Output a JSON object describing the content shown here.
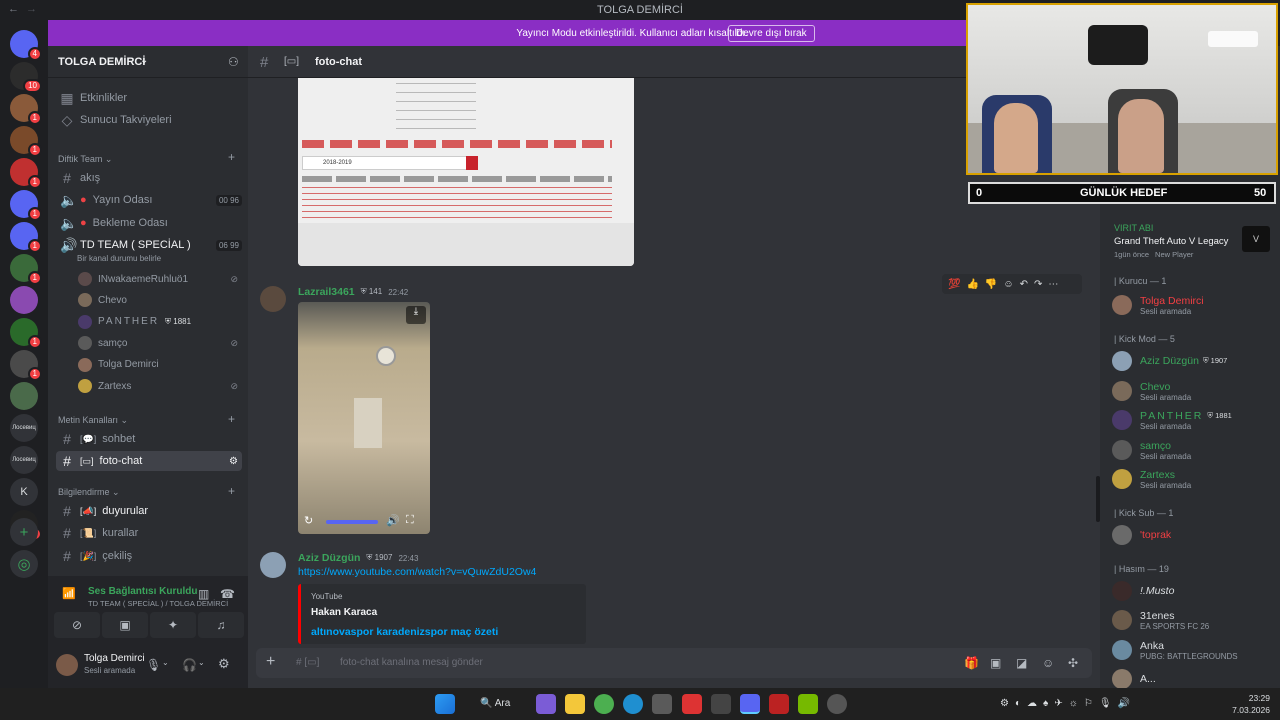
{
  "window": {
    "title": "TOLGA DEMİRCİ"
  },
  "banner": {
    "message": "Yayıncı Modu etkinleştirildi. Kullanıcı adları kısaltıldı.",
    "button": "Devre dışı bırak"
  },
  "servers": [
    {
      "badge": "4"
    },
    {
      "badge": "10"
    },
    {
      "badge": "1"
    },
    {
      "badge": "1"
    },
    {
      "badge": "1"
    },
    {
      "badge": "1"
    },
    {
      "badge": "1"
    },
    {
      "badge": "1"
    },
    {
      "badge": ""
    },
    {
      "badge": "1"
    },
    {
      "badge": "1"
    },
    {
      "badge": ""
    },
    {
      "label": "Лосевиц"
    },
    {
      "label": "Лосевиц"
    },
    {
      "label": "K"
    },
    {
      "badge": "1"
    }
  ],
  "guild": {
    "name": "TOLGA DEMİRCİ"
  },
  "nav": {
    "events": "Etkinlikler",
    "boosts": "Sunucu Takviyeleri"
  },
  "cat1": {
    "name": "Diftik Team"
  },
  "ch_akis": "akış",
  "voice": {
    "yayin": "Yayın Odası",
    "yayin_counts": "00 96",
    "bekleme": "Bekleme Odası",
    "td": "TD TEAM ( SPECİAL )",
    "td_counts": "06 99",
    "td_status": "Bir kanal durumu belirle"
  },
  "voice_users": [
    "INwakaemeRuhluö1",
    "Chevo",
    "PANTHER",
    "samço",
    "Tolga Demirci",
    "Zartexs"
  ],
  "panther_badge": "1881",
  "cat2": {
    "name": "Metin Kanalları"
  },
  "ch_sohbet": "sohbet",
  "ch_foto": "foto-chat",
  "cat3": {
    "name": "Bilgilendirme"
  },
  "ch_duyurular": "duyurular",
  "ch_kurallar": "kurallar",
  "ch_cekilis": "çekiliş",
  "vp": {
    "status": "Ses Bağlantısı Kuruldu",
    "location": "TD TEAM ( SPECİAL ) / TOLGA DEMİRCİ"
  },
  "me": {
    "name": "Tolga Demirci",
    "status": "Sesli aramada"
  },
  "header": {
    "channel": "foto-chat"
  },
  "doc": {
    "season": "2018-2019"
  },
  "msg1": {
    "author": "Lazrail3461",
    "badge": "141",
    "time": "22:42"
  },
  "msg2": {
    "author": "Aziz Düzgün",
    "badge": "1907",
    "time": "22:43",
    "link": "https://www.youtube.com/watch?v=vQuwZdU2Ow4",
    "embed_provider": "YouTube",
    "embed_author": "Hakan Karaca",
    "embed_title": "altınovaspor karadenizspor maç özeti"
  },
  "composer": {
    "placeholder": "foto-chat kanalına mesaj gönder"
  },
  "stream": {
    "goal_left": "0",
    "goal_label": "GÜNLÜK HEDEF",
    "goal_right": "50"
  },
  "activity": {
    "name": "VIRIT ABI",
    "game": "Grand Theft Auto V Legacy",
    "meta": "1gün önce",
    "tag": "New Player"
  },
  "mcat": {
    "kurucu": "| Kurucu — 1",
    "kickmod": "| Kick Mod — 5",
    "kicksub": "| Kick Sub — 1",
    "hasim": "| Hasım — 19"
  },
  "members": {
    "tolga": {
      "name": "Tolga Demirci",
      "sub": "Sesli aramada",
      "color": "#f23f43"
    },
    "aziz": {
      "name": "Aziz Düzgün",
      "badge": "1907",
      "color": "#3ba55c"
    },
    "chevo": {
      "name": "Chevo",
      "sub": "Sesli aramada",
      "color": "#3ba55c"
    },
    "panther": {
      "name": "PANTHER",
      "badge": "1881",
      "sub": "Sesli aramada",
      "color": "#3ba55c"
    },
    "samco": {
      "name": "samço",
      "sub": "Sesli aramada",
      "color": "#3ba55c"
    },
    "zartexs": {
      "name": "Zartexs",
      "sub": "Sesli aramada",
      "color": "#3ba55c"
    },
    "toprak": {
      "name": "'toprak",
      "color": "#f23f43"
    },
    "musto": {
      "name": "!.Musto",
      "color": "#dbdee1"
    },
    "31enes": {
      "name": "31enes",
      "sub": "EA SPORTS FC 26",
      "color": "#dbdee1"
    },
    "anka": {
      "name": "Anka",
      "sub": "PUBG: BATTLEGROUNDS",
      "color": "#dbdee1"
    },
    "a": {
      "name": "A...",
      "color": "#dbdee1"
    }
  },
  "taskbar": {
    "search": "Ara",
    "time": "23:29",
    "date": "7.03.2026"
  }
}
